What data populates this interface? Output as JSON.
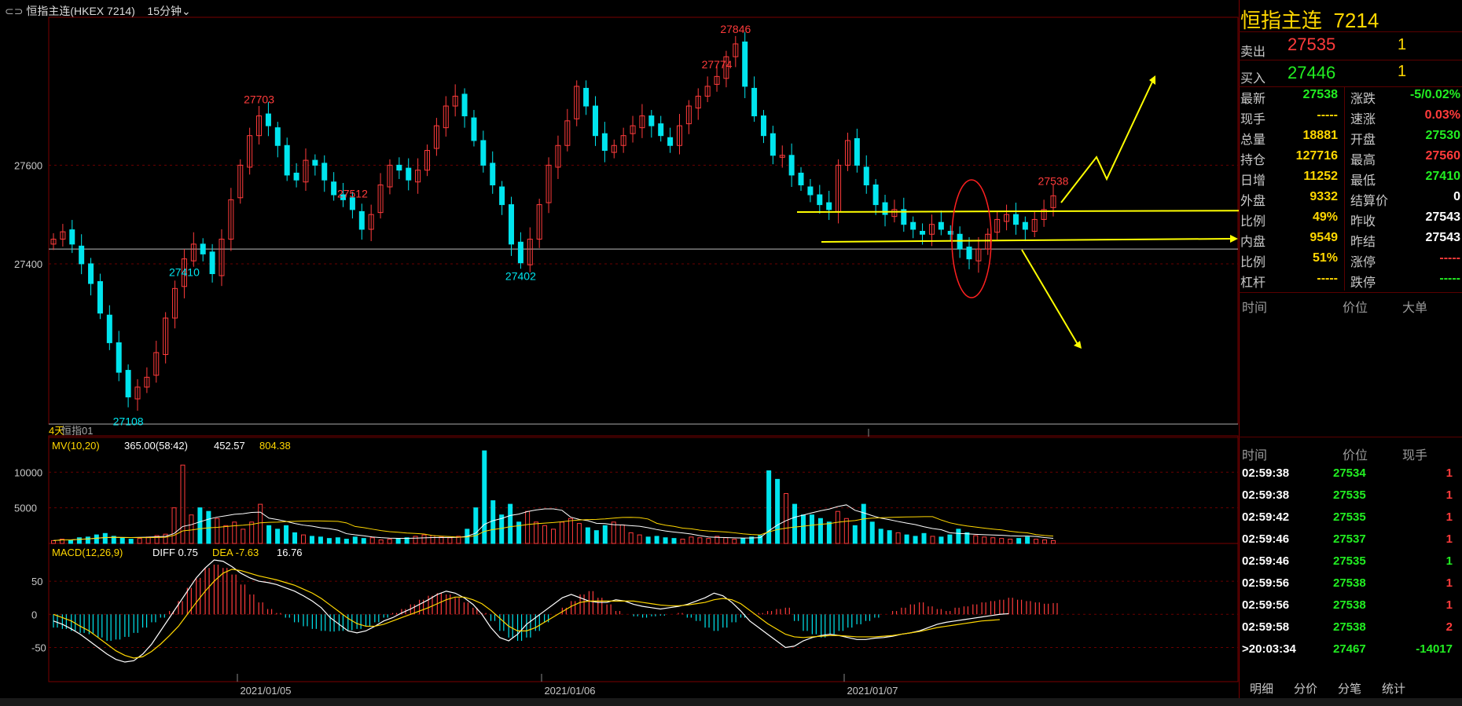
{
  "header": {
    "instrument": "恒指主连(HKEX 7214)",
    "period": "15分钟"
  },
  "panel": {
    "title": "恒指主连",
    "code": "7214",
    "ask_label": "卖出",
    "ask_price": "27535",
    "ask_qty": "1",
    "bid_label": "买入",
    "bid_price": "27446",
    "bid_qty": "1",
    "stats_left": [
      {
        "label": "最新",
        "value": "27538",
        "color": "green"
      },
      {
        "label": "现手",
        "value": "-----",
        "color": "yellow"
      },
      {
        "label": "总量",
        "value": "18881",
        "color": "yellow"
      },
      {
        "label": "持仓",
        "value": "127716",
        "color": "yellow"
      },
      {
        "label": "日增",
        "value": "11252",
        "color": "yellow"
      },
      {
        "label": "外盘",
        "value": "9332",
        "color": "yellow"
      },
      {
        "label": "比例",
        "value": "49%",
        "color": "yellow"
      },
      {
        "label": "内盘",
        "value": "9549",
        "color": "yellow"
      },
      {
        "label": "比例",
        "value": "51%",
        "color": "yellow"
      },
      {
        "label": "杠杆",
        "value": "-----",
        "color": "yellow"
      }
    ],
    "stats_right": [
      {
        "label": "涨跌",
        "value": "-5/0.02%",
        "color": "green"
      },
      {
        "label": "速涨",
        "value": "0.03%",
        "color": "red"
      },
      {
        "label": "开盘",
        "value": "27530",
        "color": "green"
      },
      {
        "label": "最高",
        "value": "27560",
        "color": "red"
      },
      {
        "label": "最低",
        "value": "27410",
        "color": "green"
      },
      {
        "label": "结算价",
        "value": "0",
        "color": "white"
      },
      {
        "label": "昨收",
        "value": "27543",
        "color": "white"
      },
      {
        "label": "昨结",
        "value": "27543",
        "color": "white"
      },
      {
        "label": "涨停",
        "value": "-----",
        "color": "red"
      },
      {
        "label": "跌停",
        "value": "-----",
        "color": "green"
      }
    ],
    "big_orders_headers": [
      "时间",
      "价位",
      "大单"
    ],
    "trades_headers": [
      "时间",
      "价位",
      "现手"
    ],
    "trades": [
      {
        "time": "02:59:38",
        "price": "27534",
        "qty": "1",
        "qty_color": "red"
      },
      {
        "time": "02:59:38",
        "price": "27535",
        "qty": "1",
        "qty_color": "red"
      },
      {
        "time": "02:59:42",
        "price": "27535",
        "qty": "1",
        "qty_color": "red"
      },
      {
        "time": "02:59:46",
        "price": "27537",
        "qty": "1",
        "qty_color": "red"
      },
      {
        "time": "02:59:46",
        "price": "27535",
        "qty": "1",
        "qty_color": "green"
      },
      {
        "time": "02:59:56",
        "price": "27538",
        "qty": "1",
        "qty_color": "red"
      },
      {
        "time": "02:59:56",
        "price": "27538",
        "qty": "1",
        "qty_color": "red"
      },
      {
        "time": "02:59:58",
        "price": "27538",
        "qty": "2",
        "qty_color": "red"
      },
      {
        "time": ">20:03:34",
        "price": "27467",
        "qty": "-14017",
        "qty_color": "green"
      }
    ],
    "tabs": [
      "明细",
      "分价",
      "分笔",
      "统计"
    ]
  },
  "colors": {
    "up": "#ff3b3b",
    "down": "#00e5ee",
    "ma_white": "#ffffff",
    "ma_yellow": "#ffd700",
    "annotation": "#ffff00",
    "grid": "#6a0000"
  },
  "chart_data": [
    {
      "type": "candlestick",
      "title": "",
      "ylabel": "",
      "ylim": [
        27075,
        27900
      ],
      "y_ticks": [
        27400,
        27600
      ],
      "y_tick_labels": [
        "27400",
        "27600"
      ],
      "x_tick_labels": [
        "2021/01/05",
        "2021/01/06",
        "2021/01/07"
      ],
      "reference_line": 27430,
      "annotations": [
        {
          "text": "27512",
          "value": 27512,
          "color": "red"
        },
        {
          "text": "27703",
          "value": 27703,
          "color": "red"
        },
        {
          "text": "27774",
          "value": 27774,
          "color": "red"
        },
        {
          "text": "27846",
          "value": 27846,
          "color": "red"
        },
        {
          "text": "27538",
          "value": 27538,
          "color": "red"
        },
        {
          "text": "27402",
          "value": 27402,
          "color": "cyan"
        },
        {
          "text": "27410",
          "value": 27410,
          "color": "cyan"
        },
        {
          "text": "27108",
          "value": 27108,
          "color": "cyan"
        }
      ],
      "sub_label": "4天",
      "sub_label2": "恒指01",
      "close_path": [
        27450,
        27465,
        27440,
        27400,
        27360,
        27300,
        27240,
        27180,
        27130,
        27150,
        27170,
        27220,
        27290,
        27350,
        27410,
        27440,
        27420,
        27380,
        27450,
        27530,
        27600,
        27660,
        27700,
        27680,
        27640,
        27580,
        27570,
        27610,
        27600,
        27570,
        27540,
        27530,
        27510,
        27470,
        27500,
        27560,
        27600,
        27590,
        27570,
        27590,
        27630,
        27680,
        27720,
        27740,
        27700,
        27650,
        27600,
        27560,
        27520,
        27440,
        27402,
        27450,
        27520,
        27600,
        27640,
        27690,
        27760,
        27720,
        27660,
        27630,
        27640,
        27660,
        27680,
        27700,
        27680,
        27660,
        27640,
        27680,
        27720,
        27740,
        27760,
        27780,
        27820,
        27846,
        27760,
        27700,
        27660,
        27620,
        27620,
        27580,
        27560,
        27540,
        27520,
        27510,
        27600,
        27650,
        27600,
        27560,
        27520,
        27500,
        27510,
        27480,
        27470,
        27460,
        27480,
        27470,
        27460,
        27430,
        27410,
        27430,
        27460,
        27490,
        27500,
        27480,
        27470,
        27490,
        27510,
        27538
      ]
    },
    {
      "type": "bar",
      "title": "MV(10,20)",
      "values_text": [
        "365.00(58:42)",
        "452.57",
        "804.38"
      ],
      "y_ticks": [
        5000,
        10000
      ],
      "y_tick_labels": [
        "5000",
        "10000"
      ],
      "ylim": [
        0,
        14000
      ],
      "volume_path": [
        400,
        600,
        500,
        800,
        900,
        1200,
        1400,
        1000,
        800,
        600,
        700,
        900,
        1100,
        1300,
        5000,
        11000,
        4000,
        5000,
        4500,
        3500,
        2500,
        3000,
        2000,
        3000,
        5500,
        2500,
        2000,
        2500,
        1500,
        1200,
        1000,
        900,
        700,
        800,
        600,
        900,
        700,
        800,
        500,
        600,
        700,
        800,
        1000,
        1200,
        1100,
        900,
        800,
        1000,
        2000,
        5000,
        13000,
        6000,
        4000,
        5500,
        3000,
        4500,
        3000,
        2500,
        2000,
        3000,
        3500,
        2800,
        2200,
        1800,
        2500,
        3000,
        2600,
        1500,
        1200,
        900,
        1000,
        800,
        700,
        600,
        900,
        800,
        700,
        1000,
        800,
        600,
        700,
        900,
        1100,
        10200,
        9000,
        7000,
        5500,
        4000,
        4000,
        3500,
        3000,
        4500,
        3500,
        2500,
        5500,
        3000,
        2000,
        1800,
        1500,
        1200,
        1000,
        1400,
        1000,
        900,
        1200,
        2000,
        1500,
        1100,
        900,
        800,
        700,
        600,
        700,
        900,
        600,
        500,
        400
      ]
    },
    {
      "type": "bar",
      "title": "MACD(12,26,9)",
      "values_text": [
        "DIFF 0.75",
        "DEA -7.63",
        "16.76"
      ],
      "y_ticks": [
        50,
        0,
        -50
      ],
      "y_tick_labels": [
        "50",
        "0",
        "-50"
      ],
      "ylim": [
        -85,
        88
      ],
      "macd_hist": [
        -20,
        -22,
        -25,
        -28,
        -30,
        -35,
        -40,
        -38,
        -34,
        -28,
        -20,
        -12,
        -5,
        5,
        20,
        40,
        55,
        70,
        75,
        70,
        60,
        45,
        30,
        18,
        8,
        2,
        -5,
        -12,
        -18,
        -22,
        -25,
        -26,
        -25,
        -24,
        -22,
        -18,
        -12,
        -5,
        2,
        8,
        15,
        22,
        28,
        32,
        30,
        25,
        18,
        10,
        2,
        -10,
        -25,
        -35,
        -40,
        -35,
        -25,
        -12,
        0,
        10,
        20,
        30,
        35,
        25,
        15,
        5,
        0,
        -3,
        -5,
        -3,
        -2,
        0,
        2,
        -5,
        -10,
        -20,
        -25,
        -20,
        -12,
        -5,
        0,
        2,
        5,
        8,
        10,
        -10,
        -25,
        -30,
        -35,
        -30,
        -25,
        -20,
        -15,
        -10,
        -5,
        0,
        5,
        10,
        15,
        18,
        12,
        8,
        5,
        10,
        12,
        15,
        18,
        20,
        22,
        25,
        22,
        20,
        18,
        16,
        17
      ],
      "diff_path": [
        -10,
        -15,
        -22,
        -30,
        -40,
        -50,
        -60,
        -68,
        -72,
        -70,
        -60,
        -45,
        -25,
        -5,
        15,
        35,
        55,
        70,
        82,
        80,
        72,
        62,
        55,
        50,
        48,
        45,
        40,
        35,
        28,
        20,
        10,
        -5,
        -15,
        -25,
        -28,
        -25,
        -18,
        -10,
        -5,
        2,
        8,
        15,
        22,
        30,
        35,
        32,
        25,
        15,
        0,
        -20,
        -35,
        -40,
        -30,
        -15,
        -5,
        5,
        15,
        25,
        30,
        25,
        20,
        18,
        18,
        22,
        20,
        15,
        12,
        10,
        8,
        10,
        12,
        15,
        20,
        25,
        32,
        28,
        18,
        5,
        -10,
        -20,
        -30,
        -40,
        -50,
        -48,
        -40,
        -35,
        -32,
        -30,
        -32,
        -35,
        -38,
        -38,
        -36,
        -35,
        -33,
        -30,
        -28,
        -25,
        -20,
        -15,
        -12,
        -10,
        -8,
        -6,
        -4,
        -2,
        0,
        1
      ],
      "dea_path": [
        0,
        -5,
        -10,
        -18,
        -25,
        -35,
        -45,
        -55,
        -62,
        -66,
        -64,
        -56,
        -45,
        -32,
        -18,
        0,
        18,
        35,
        50,
        62,
        68,
        66,
        62,
        58,
        55,
        52,
        48,
        44,
        38,
        32,
        24,
        14,
        4,
        -6,
        -14,
        -18,
        -18,
        -15,
        -10,
        -5,
        0,
        5,
        10,
        16,
        22,
        26,
        26,
        22,
        16,
        6,
        -6,
        -18,
        -25,
        -25,
        -20,
        -12,
        -4,
        4,
        12,
        18,
        20,
        20,
        20,
        20,
        20,
        20,
        18,
        16,
        14,
        13,
        13,
        14,
        16,
        18,
        22,
        24,
        22,
        16,
        6,
        -4,
        -14,
        -22,
        -30,
        -34,
        -35,
        -34,
        -33,
        -32,
        -32,
        -33,
        -34,
        -34,
        -34,
        -33,
        -32,
        -30,
        -28,
        -26,
        -23,
        -20,
        -18,
        -16,
        -14,
        -12,
        -10,
        -9,
        -8
      ]
    }
  ]
}
